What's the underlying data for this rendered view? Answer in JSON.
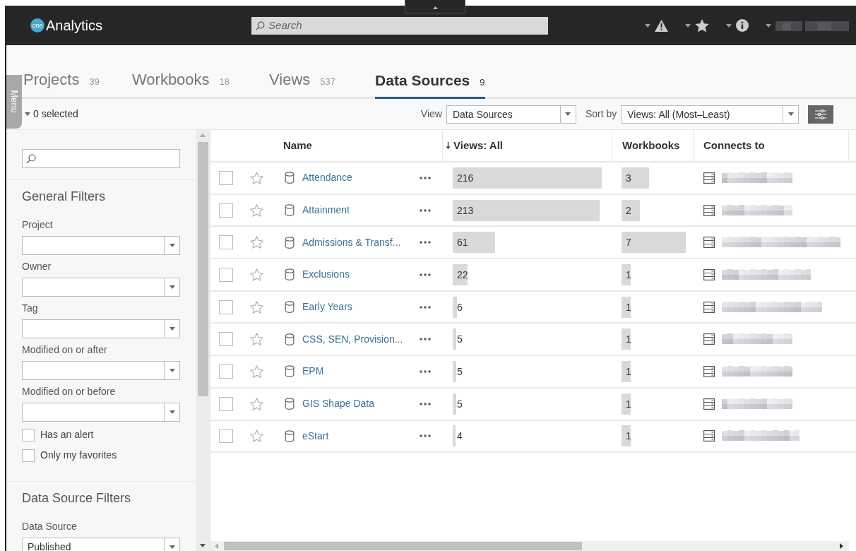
{
  "header": {
    "logo_badge": "one",
    "app_name": "Analytics",
    "search": {
      "placeholder": "Search"
    }
  },
  "tabs": [
    {
      "label": "Projects",
      "count": "39",
      "selected": false
    },
    {
      "label": "Workbooks",
      "count": "18",
      "selected": false
    },
    {
      "label": "Views",
      "count": "537",
      "selected": false
    },
    {
      "label": "Data Sources",
      "count": "9",
      "selected": true
    }
  ],
  "menu_tab": "Menu",
  "toolbar": {
    "selection": "0 selected",
    "view_label": "View",
    "view_value": "Data Sources",
    "sort_label": "Sort by",
    "sort_value": "Views: All (Most–Least)"
  },
  "sidebar": {
    "general_title": "General Filters",
    "filters": [
      {
        "label": "Project"
      },
      {
        "label": "Owner"
      },
      {
        "label": "Tag"
      },
      {
        "label": "Modified on or after"
      },
      {
        "label": "Modified on or before"
      }
    ],
    "checkboxes": [
      {
        "label": "Has an alert",
        "checked": false
      },
      {
        "label": "Only my favorites",
        "checked": false
      }
    ],
    "data_source_title": "Data Source Filters",
    "data_source_filters": [
      {
        "label": "Data Source",
        "value": "Published"
      }
    ]
  },
  "table": {
    "columns": [
      {
        "label": "Name",
        "sorted": false
      },
      {
        "label": "Views: All",
        "sorted": true
      },
      {
        "label": "Workbooks",
        "sorted": false
      },
      {
        "label": "Connects to",
        "sorted": false
      }
    ],
    "rows": [
      {
        "selected": false,
        "favorite": false,
        "name": "Attendance",
        "views": "216",
        "workbooks": "3"
      },
      {
        "selected": false,
        "favorite": false,
        "name": "Attainment",
        "views": "213",
        "workbooks": "2"
      },
      {
        "selected": false,
        "favorite": false,
        "name": "Admissions & Transf...",
        "views": "61",
        "workbooks": "7"
      },
      {
        "selected": false,
        "favorite": false,
        "name": "Exclusions",
        "views": "22",
        "workbooks": "1"
      },
      {
        "selected": false,
        "favorite": false,
        "name": "Early Years",
        "views": "6",
        "workbooks": "1"
      },
      {
        "selected": false,
        "favorite": false,
        "name": "CSS, SEN, Provision...",
        "views": "5",
        "workbooks": "1"
      },
      {
        "selected": false,
        "favorite": false,
        "name": "EPM",
        "views": "5",
        "workbooks": "1"
      },
      {
        "selected": false,
        "favorite": false,
        "name": "GIS Shape Data",
        "views": "5",
        "workbooks": "1"
      },
      {
        "selected": false,
        "favorite": false,
        "name": "eStart",
        "views": "4",
        "workbooks": "1"
      }
    ]
  }
}
